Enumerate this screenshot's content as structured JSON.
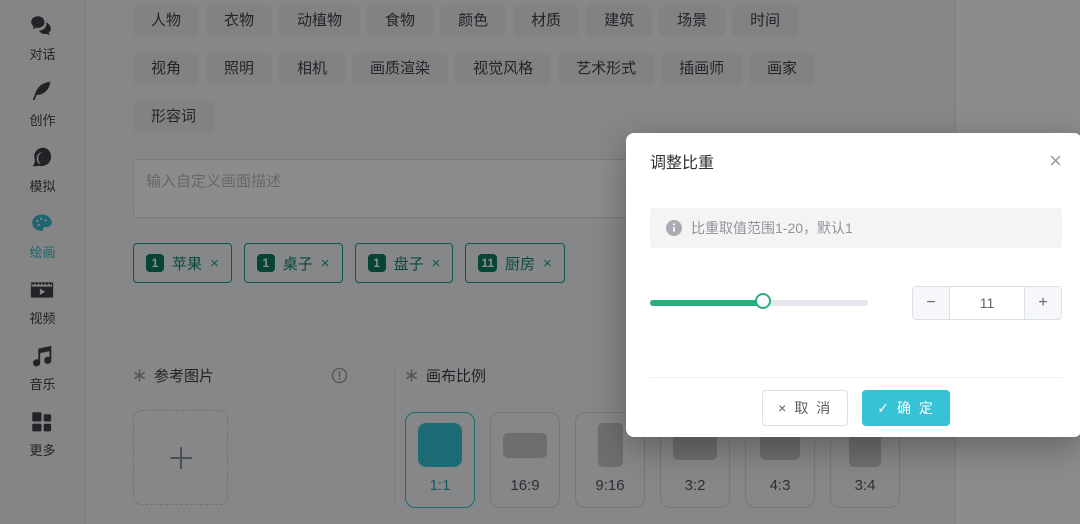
{
  "sidebar": {
    "items": [
      {
        "key": "chat",
        "label": "对话",
        "icon": "chat-icon",
        "active": false
      },
      {
        "key": "create",
        "label": "创作",
        "icon": "quill-icon",
        "active": false
      },
      {
        "key": "simulate",
        "label": "模拟",
        "icon": "persona-icon",
        "active": false
      },
      {
        "key": "draw",
        "label": "绘画",
        "icon": "palette-icon",
        "active": true
      },
      {
        "key": "video",
        "label": "视频",
        "icon": "video-icon",
        "active": false
      },
      {
        "key": "music",
        "label": "音乐",
        "icon": "music-icon",
        "active": false
      },
      {
        "key": "more",
        "label": "更多",
        "icon": "grid-icon",
        "active": false
      }
    ]
  },
  "categories": {
    "rows": [
      [
        "人物",
        "衣物",
        "动植物",
        "食物",
        "颜色",
        "材质",
        "建筑",
        "场景",
        "时间"
      ],
      [
        "视角",
        "照明",
        "相机",
        "画质渲染",
        "视觉风格",
        "艺术形式",
        "插画师",
        "画家"
      ],
      [
        "形容词"
      ]
    ]
  },
  "prompt_input": {
    "placeholder": "输入自定义画面描述",
    "value": ""
  },
  "weight_tags": {
    "items": [
      {
        "weight": "1",
        "label": "苹果",
        "remove": "×"
      },
      {
        "weight": "1",
        "label": "桌子",
        "remove": "×"
      },
      {
        "weight": "1",
        "label": "盘子",
        "remove": "×"
      },
      {
        "weight": "11",
        "label": "厨房",
        "remove": "×"
      }
    ]
  },
  "sections": {
    "reference": {
      "marker_icon": "asterisk-icon",
      "title": "参考图片",
      "hint_icon": "info-circle-icon",
      "upload_icon": "plus-icon"
    },
    "ratio": {
      "marker_icon": "asterisk-icon",
      "title": "画布比例",
      "options": [
        {
          "label": "1:1",
          "selected": true,
          "swatch_w": 44,
          "swatch_h": 44
        },
        {
          "label": "16:9",
          "selected": false,
          "swatch_w": 44,
          "swatch_h": 25
        },
        {
          "label": "9:16",
          "selected": false,
          "swatch_w": 25,
          "swatch_h": 44
        },
        {
          "label": "3:2",
          "selected": false,
          "swatch_w": 44,
          "swatch_h": 29
        },
        {
          "label": "4:3",
          "selected": false,
          "swatch_w": 40,
          "swatch_h": 30
        },
        {
          "label": "3:4",
          "selected": false,
          "swatch_w": 32,
          "swatch_h": 44
        }
      ]
    }
  },
  "modal": {
    "title": "调整比重",
    "close": "×",
    "info_icon": "info-filled-icon",
    "info_text": "比重取值范围1-20，默认1",
    "slider": {
      "min": 1,
      "max": 20,
      "value": 11
    },
    "stepper": {
      "minus": "−",
      "value": "11",
      "plus": "+"
    },
    "cancel": {
      "icon": "×",
      "label": "取 消"
    },
    "confirm": {
      "icon": "✓",
      "label": "确 定"
    }
  },
  "colors": {
    "accent_cyan": "#35c3d5",
    "sidebar_active": "#35b9cb",
    "slider_green": "#26b17c",
    "tag_border_green": "#18a385",
    "tag_badge_green": "#0b7d5e",
    "overlay": "rgba(0,0,0,0.45)"
  }
}
